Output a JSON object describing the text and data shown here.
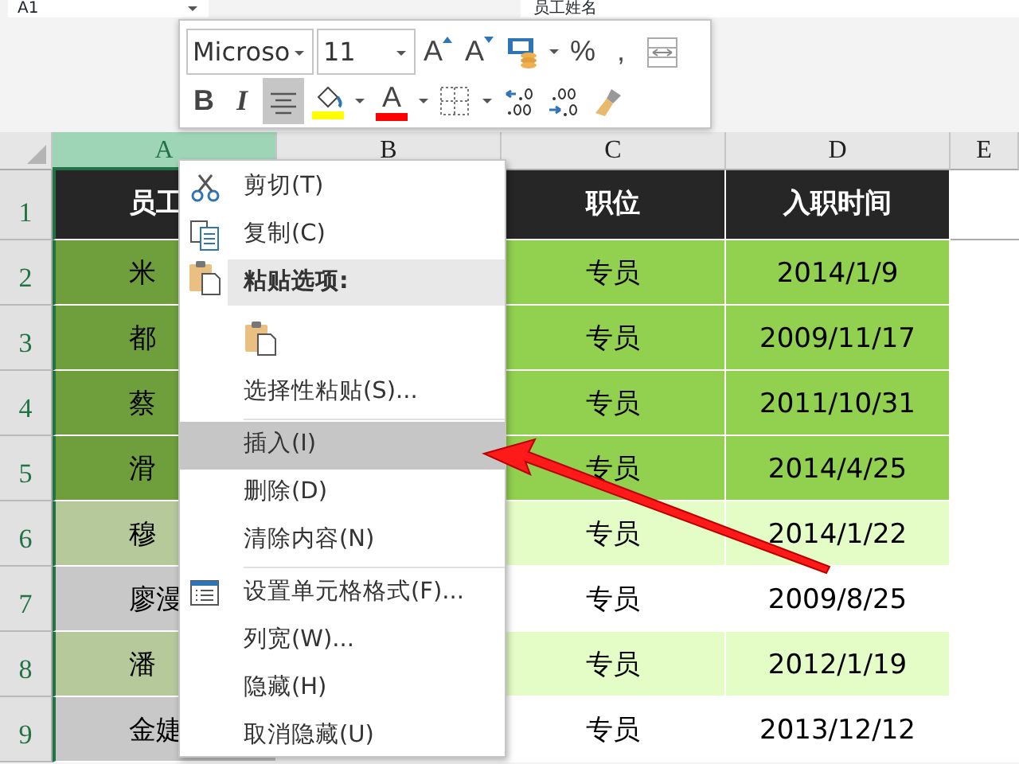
{
  "formula_bar": {
    "name_box": "A1",
    "formula": "员工姓名"
  },
  "mini_toolbar": {
    "font": "Microso",
    "size": "11",
    "rows": [
      [
        {
          "kind": "grow",
          "label": "A"
        },
        {
          "kind": "shrink",
          "label": "A"
        },
        {
          "kind": "currency"
        },
        {
          "kind": "caret"
        },
        {
          "kind": "text",
          "label": "%"
        },
        {
          "kind": "text",
          "label": ","
        },
        {
          "kind": "wrap"
        }
      ],
      [
        {
          "kind": "bold",
          "label": "B"
        },
        {
          "kind": "italic",
          "label": "I"
        },
        {
          "kind": "align",
          "selected": true
        },
        {
          "kind": "fill-color",
          "color": "#ffff00"
        },
        {
          "kind": "caret"
        },
        {
          "kind": "font-color",
          "label": "A",
          "color": "#ff0000"
        },
        {
          "kind": "caret"
        },
        {
          "kind": "borders"
        },
        {
          "kind": "caret"
        },
        {
          "kind": "add-decimal"
        },
        {
          "kind": "remove-decimal"
        },
        {
          "kind": "painter"
        }
      ]
    ]
  },
  "sheet": {
    "columns": [
      {
        "label": "A",
        "selected": true
      },
      {
        "label": "B",
        "selected": false
      },
      {
        "label": "C",
        "selected": false
      },
      {
        "label": "D",
        "selected": false
      },
      {
        "label": "E",
        "selected": false
      }
    ],
    "rows": [
      {
        "number": "1",
        "kind": "header",
        "name": "员工",
        "position": "职位",
        "start_date": "入职时间"
      },
      {
        "number": "2",
        "kind": "dark",
        "name": "米",
        "position": "专员",
        "start_date": "2014/1/9"
      },
      {
        "number": "3",
        "kind": "dark",
        "name": "都",
        "position": "专员",
        "start_date": "2009/11/17"
      },
      {
        "number": "4",
        "kind": "dark",
        "name": "蔡",
        "position": "专员",
        "start_date": "2011/10/31"
      },
      {
        "number": "5",
        "kind": "dark",
        "name": "滑",
        "position": "专员",
        "start_date": "2014/4/25"
      },
      {
        "number": "6",
        "kind": "light",
        "name": "穆",
        "position": "专员",
        "start_date": "2014/1/22"
      },
      {
        "number": "7",
        "kind": "plain",
        "name": "廖漫",
        "position": "专员",
        "start_date": "2009/8/25"
      },
      {
        "number": "8",
        "kind": "light",
        "name": "潘",
        "position": "专员",
        "start_date": "2012/1/19"
      },
      {
        "number": "9",
        "kind": "plain",
        "name": "金婕",
        "position": "专员",
        "start_date": "2013/12/12"
      }
    ]
  },
  "context_menu": [
    {
      "kind": "cut",
      "label": "剪切(T)",
      "selected": false
    },
    {
      "kind": "copy",
      "label": "复制(C)",
      "selected": false
    },
    {
      "kind": "paste-heading",
      "label": "粘贴选项:"
    },
    {
      "kind": "paste-options"
    },
    {
      "kind": "command",
      "label": "选择性粘贴(S)...",
      "selected": false
    },
    {
      "kind": "separator"
    },
    {
      "kind": "command",
      "label": "插入(I)",
      "selected": true
    },
    {
      "kind": "command",
      "label": "删除(D)",
      "selected": false
    },
    {
      "kind": "command",
      "label": "清除内容(N)",
      "selected": false
    },
    {
      "kind": "separator"
    },
    {
      "kind": "format",
      "label": "设置单元格格式(F)...",
      "selected": false
    },
    {
      "kind": "command",
      "label": "列宽(W)...",
      "selected": false
    },
    {
      "kind": "command",
      "label": "隐藏(H)",
      "selected": false
    },
    {
      "kind": "command",
      "label": "取消隐藏(U)",
      "selected": false
    }
  ],
  "annotation": {
    "kind": "arrow"
  }
}
